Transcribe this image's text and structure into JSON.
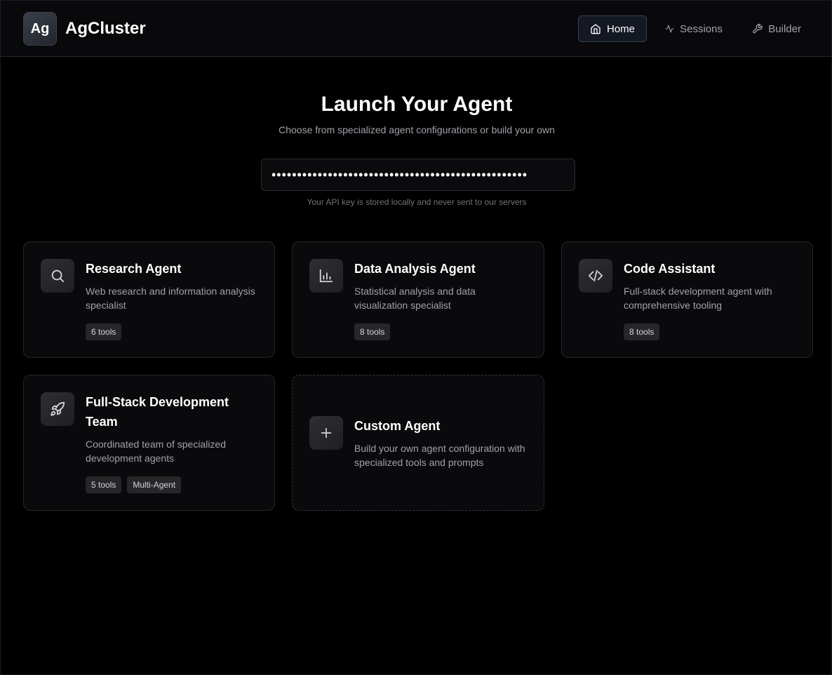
{
  "header": {
    "logo_text": "Ag",
    "brand": "AgCluster",
    "nav": [
      {
        "label": "Home",
        "icon": "home-icon",
        "active": true
      },
      {
        "label": "Sessions",
        "icon": "activity-icon",
        "active": false
      },
      {
        "label": "Builder",
        "icon": "wrench-icon",
        "active": false
      }
    ]
  },
  "hero": {
    "title": "Launch Your Agent",
    "subtitle": "Choose from specialized agent configurations or build your own"
  },
  "api_key": {
    "value": "••••••••••••••••••••••••••••••••••••••••••••••••••",
    "note": "Your API key is stored locally and never sent to our servers"
  },
  "cards": [
    {
      "title": "Research Agent",
      "description": "Web research and information analysis specialist",
      "icon": "search-icon",
      "tags": [
        "6 tools"
      ]
    },
    {
      "title": "Data Analysis Agent",
      "description": "Statistical analysis and data visualization specialist",
      "icon": "bar-chart-icon",
      "tags": [
        "8 tools"
      ]
    },
    {
      "title": "Code Assistant",
      "description": "Full-stack development agent with comprehensive tooling",
      "icon": "code-icon",
      "tags": [
        "8 tools"
      ]
    },
    {
      "title": "Full-Stack Development Team",
      "description": "Coordinated team of specialized development agents",
      "icon": "rocket-icon",
      "tags": [
        "5 tools",
        "Multi-Agent"
      ]
    },
    {
      "title": "Custom Agent",
      "description": "Build your own agent configuration with specialized tools and prompts",
      "icon": "plus-icon",
      "tags": []
    }
  ],
  "colors": {
    "background": "#000000",
    "header_bg": "#09090b",
    "card_bg": "#0a0a0c",
    "muted_text": "#a1a1aa",
    "tag_bg": "#27272a"
  }
}
